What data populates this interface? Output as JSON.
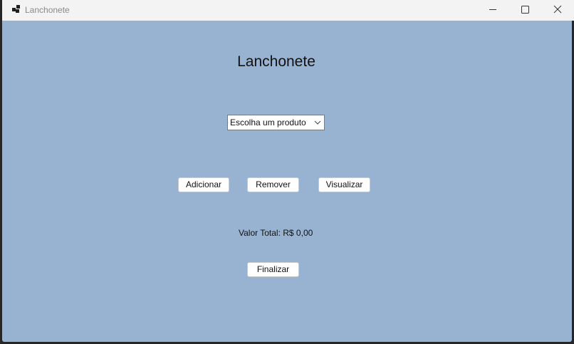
{
  "window": {
    "title": "Lanchonete",
    "icons": {
      "app": "app-icon",
      "minimize": "minimize-icon",
      "maximize": "maximize-icon",
      "close": "close-icon"
    }
  },
  "main": {
    "heading": "Lanchonete",
    "product_select": {
      "selected": "Escolha um produto",
      "icon": "chevron-down-icon"
    },
    "buttons": {
      "add": "Adicionar",
      "remove": "Remover",
      "view": "Visualizar",
      "finish": "Finalizar"
    },
    "total_label": "Valor Total: R$ 0,00"
  },
  "colors": {
    "background": "#98b3d1",
    "titlebar": "#f3f3f3"
  }
}
